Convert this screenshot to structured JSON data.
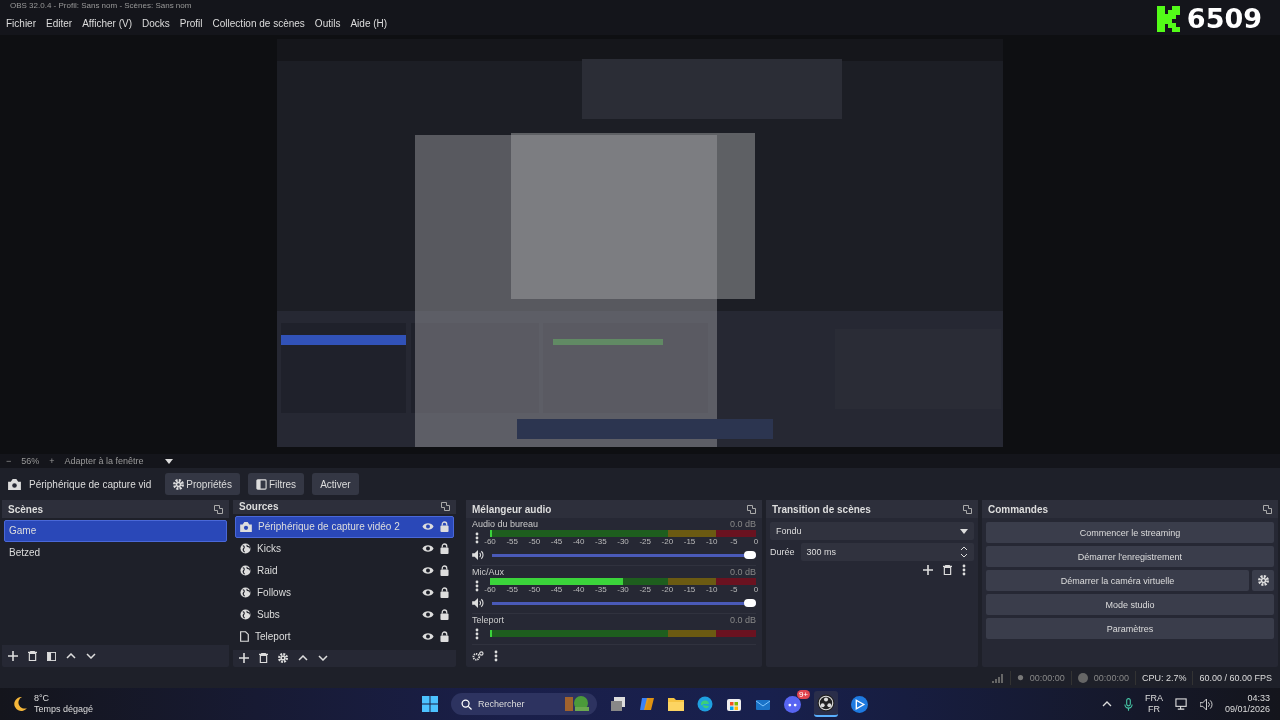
{
  "window": {
    "title": "OBS 32.0.4 - Profil: Sans nom - Scènes: Sans nom"
  },
  "menu": [
    "Fichier",
    "Editer",
    "Afficher (V)",
    "Docks",
    "Profil",
    "Collection de scènes",
    "Outils",
    "Aide (H)"
  ],
  "overlay": {
    "count": "6509"
  },
  "zoom_bar": {
    "minus": "−",
    "zoom": "56%",
    "plus": "+",
    "fit": "Adapter à la fenêtre"
  },
  "source_toolbar": {
    "source": "Périphérique de capture vid",
    "buttons": [
      {
        "label": "Propriétés",
        "kind": "gear"
      },
      {
        "label": "Filtres",
        "kind": "filter"
      },
      {
        "label": "Activer",
        "kind": "plain"
      }
    ]
  },
  "scenes": {
    "title": "Scènes",
    "items": [
      {
        "label": "Game",
        "selected": true
      },
      {
        "label": "Betzed",
        "selected": false
      }
    ]
  },
  "sources": {
    "title": "Sources",
    "items": [
      {
        "label": "Périphérique de capture vidéo 2",
        "kind": "camera",
        "selected": true,
        "visible": true,
        "locked": true
      },
      {
        "label": "Kicks",
        "kind": "globe",
        "selected": false,
        "visible": true,
        "locked": true
      },
      {
        "label": "Raid",
        "kind": "globe",
        "selected": false,
        "visible": true,
        "locked": true
      },
      {
        "label": "Follows",
        "kind": "globe",
        "selected": false,
        "visible": true,
        "locked": true
      },
      {
        "label": "Subs",
        "kind": "globe",
        "selected": false,
        "visible": true,
        "locked": true
      },
      {
        "label": "Teleport",
        "kind": "file",
        "selected": false,
        "visible": true,
        "locked": true
      }
    ]
  },
  "mixer": {
    "title": "Mélangeur audio",
    "channels": [
      {
        "name": "Audio du bureau",
        "reading": "0.0 dB",
        "level": 0,
        "volume": {
          "level": 1
        },
        "scale": [
          "-60",
          "-55",
          "-50",
          "-45",
          "-40",
          "-35",
          "-30",
          "-25",
          "-20",
          "-15",
          "-10",
          "-5",
          "0"
        ]
      },
      {
        "name": "Mic/Aux",
        "reading": "0.0 dB",
        "level": 0.5,
        "volume": {
          "level": 1
        },
        "scale": [
          "-60",
          "-55",
          "-50",
          "-45",
          "-40",
          "-35",
          "-30",
          "-25",
          "-20",
          "-15",
          "-10",
          "-5",
          "0"
        ]
      },
      {
        "name": "Teleport",
        "reading": "0.0 dB",
        "level": 0
      }
    ]
  },
  "transitions": {
    "title": "Transition de scènes",
    "transition": "Fondu",
    "duration_label": "Durée",
    "duration": "300 ms"
  },
  "controls": {
    "title": "Commandes",
    "buttons": [
      "Commencer le streaming",
      "Démarrer l'enregistrement",
      "Démarrer la caméra virtuelle",
      "Mode studio",
      "Paramètres"
    ]
  },
  "status_bar": {
    "rec_time": "00:00:00",
    "stream_time": "00:00:00",
    "cpu": "CPU: 2.7%",
    "fps": "60.00 / 60.00 FPS"
  },
  "taskbar": {
    "weather_temp": "8°C",
    "weather_text": "Temps dégagé",
    "search": "Rechercher",
    "badge": "9+",
    "lang": "FRA",
    "layout": "FR",
    "time": "04:33",
    "date": "09/01/2026"
  }
}
